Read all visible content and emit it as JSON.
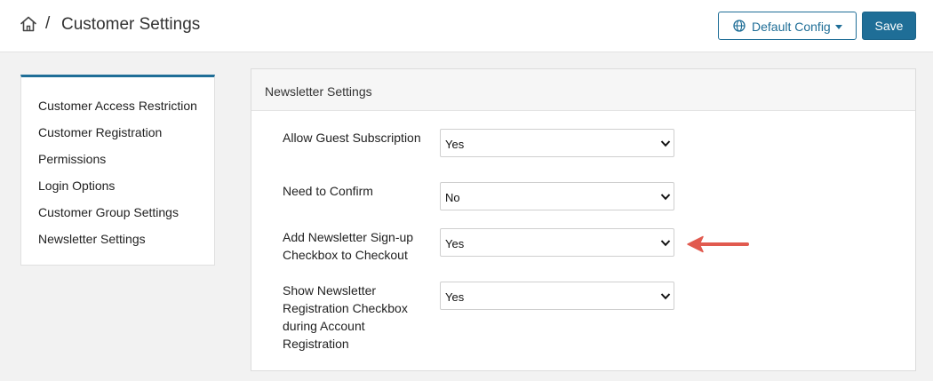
{
  "header": {
    "breadcrumb_separator": "/",
    "title": "Customer Settings",
    "config_label": "Default Config",
    "save_label": "Save",
    "home_icon": "home-icon",
    "config_icon": "globe-icon"
  },
  "sidebar": {
    "items": [
      {
        "label": "Customer Access Restriction"
      },
      {
        "label": "Customer Registration"
      },
      {
        "label": "Permissions"
      },
      {
        "label": "Login Options"
      },
      {
        "label": "Customer Group Settings"
      },
      {
        "label": "Newsletter Settings"
      }
    ]
  },
  "panel": {
    "title": "Newsletter Settings",
    "fields": [
      {
        "label": "Allow Guest Subscription",
        "value": "Yes"
      },
      {
        "label": "Need to Confirm",
        "value": "No"
      },
      {
        "label": "Add Newsletter Sign-up Checkbox to Checkout",
        "value": "Yes"
      },
      {
        "label": "Show Newsletter Registration Checkbox during Account Registration",
        "value": "Yes"
      }
    ]
  },
  "colors": {
    "accent": "#1f6e97",
    "annotation_arrow": "#e15a4f"
  }
}
